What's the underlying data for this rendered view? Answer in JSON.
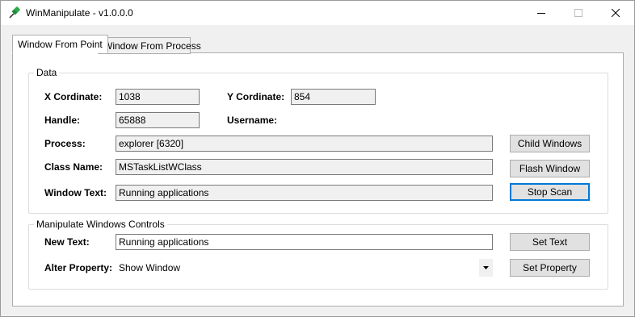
{
  "window": {
    "title": "WinManipulate - v1.0.0.0",
    "icons": {
      "app": "pushpin-icon",
      "minimize": "minimize-icon",
      "maximize": "maximize-icon",
      "close": "close-icon"
    }
  },
  "tabs": [
    {
      "label": "Window From Point",
      "active": true
    },
    {
      "label": "Window From Process",
      "active": false
    }
  ],
  "data_group": {
    "legend": "Data",
    "x_label": "X Cordinate:",
    "x_value": "1038",
    "y_label": "Y Cordinate:",
    "y_value": "854",
    "handle_label": "Handle:",
    "handle_value": "65888",
    "username_label": "Username:",
    "process_label": "Process:",
    "process_value": "explorer [6320]",
    "class_label": "Class Name:",
    "class_value": "MSTaskListWClass",
    "window_text_label": "Window Text:",
    "window_text_value": "Running applications",
    "child_windows_button": "Child Windows",
    "flash_window_button": "Flash Window",
    "stop_scan_button": "Stop Scan"
  },
  "manipulate_group": {
    "legend": "Manipulate Windows Controls",
    "new_text_label": "New Text:",
    "new_text_value": "Running applications",
    "set_text_button": "Set Text",
    "alter_property_label": "Alter Property:",
    "alter_property_selected": "Show Window",
    "set_property_button": "Set Property"
  }
}
